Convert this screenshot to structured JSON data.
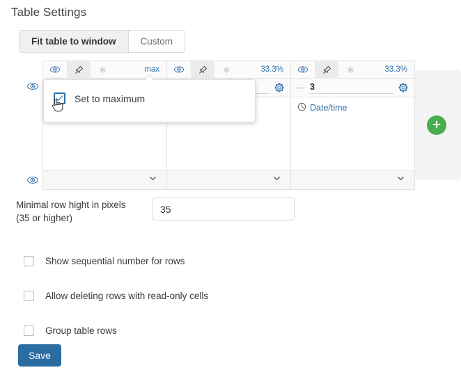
{
  "page_title": "Table Settings",
  "colors": {
    "accent_blue": "#2f6fa8",
    "save_blue": "#2b6ca3",
    "add_green": "#49ad4d",
    "active_tab_bg": "#f0f0f0"
  },
  "mode_toggle": {
    "options": [
      {
        "label": "Fit table to window",
        "active": true
      },
      {
        "label": "Custom",
        "active": false
      }
    ]
  },
  "table_builder": {
    "row_eye_icons": [
      {
        "icon": "eye-icon"
      },
      {
        "icon": "eye-icon"
      }
    ],
    "columns": [
      {
        "eye_icon": "eye-icon",
        "pin_icon": "unpin-icon",
        "required_icon": "asterisk-icon",
        "width_label": "max",
        "dash_icon": "minus-icon",
        "width_value": "",
        "gear_icon": "gear-icon",
        "field_icon": "",
        "field_label": "",
        "footer_icon": "chevron-down-icon"
      },
      {
        "eye_icon": "eye-icon",
        "pin_icon": "unpin-icon",
        "required_icon": "asterisk-icon",
        "width_label": "33.3%",
        "dash_icon": "minus-icon",
        "width_value": "",
        "gear_icon": "gear-icon",
        "field_icon": "",
        "field_label": "",
        "footer_icon": "chevron-down-icon"
      },
      {
        "eye_icon": "eye-icon",
        "pin_icon": "unpin-icon",
        "required_icon": "asterisk-icon",
        "width_label": "33.3%",
        "dash_icon": "minus-icon",
        "width_value": "3",
        "gear_icon": "gear-icon",
        "field_icon": "clock-icon",
        "field_label": "Date/time",
        "footer_icon": "chevron-down-icon"
      }
    ],
    "add_column_button": {
      "icon": "plus-icon",
      "label": ""
    }
  },
  "popover": {
    "label": "Set to maximum",
    "checkbox_checked": true,
    "checkbox_icon": "checkbox-checked-icon",
    "cursor_icon": "pointer-hand-cursor"
  },
  "min_row_height": {
    "label": "Minimal row hight in pixels (35 or higher)",
    "label_line1": "Minimal row hight in pixels",
    "label_line2": "(35 or higher)",
    "value": "35",
    "placeholder": "35"
  },
  "options": [
    {
      "label": "Show sequential number for rows",
      "checked": false
    },
    {
      "label": "Allow deleting rows with read-only cells",
      "checked": false
    },
    {
      "label": "Group table rows",
      "checked": false
    }
  ],
  "save_button": {
    "label": "Save"
  }
}
